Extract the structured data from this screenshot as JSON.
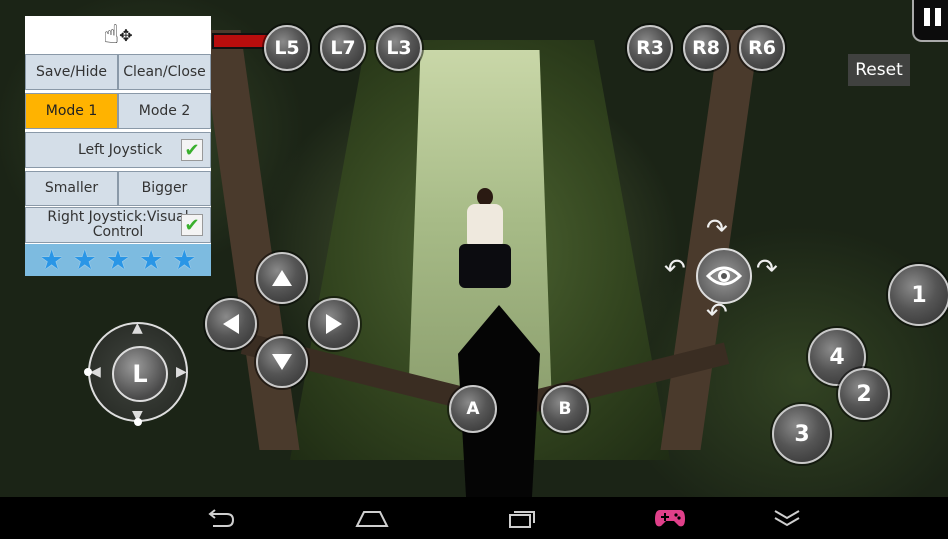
{
  "top_buttons_left": [
    "L5",
    "L7",
    "L3"
  ],
  "top_buttons_right": [
    "R3",
    "R8",
    "R6"
  ],
  "reset_label": "Reset",
  "panel": {
    "drag_icon": "hand-move-icon",
    "save_hide": "Save/Hide",
    "clean_close": "Clean/Close",
    "mode1": "Mode 1",
    "mode2": "Mode 2",
    "active_mode": "Mode 1",
    "left_joystick": "Left Joystick",
    "left_joystick_checked": true,
    "smaller": "Smaller",
    "bigger": "Bigger",
    "right_joystick_line1": "Right Joystick:Visual",
    "right_joystick_line2": "Control",
    "right_joystick_checked": true,
    "rating_stars": 5
  },
  "joystick_label": "L",
  "action_buttons": [
    "A",
    "B"
  ],
  "number_buttons": [
    "1",
    "4",
    "2",
    "3"
  ],
  "colors": {
    "active_mode": "#ffb300",
    "panel_cell": "#d4dee8",
    "stars_bg": "#7dbbe0",
    "star": "#2a96e6",
    "check": "#3ab02e",
    "gamepad_icon": "#e0408a"
  },
  "nav_icons": [
    "back-icon",
    "home-icon",
    "recents-icon",
    "gamepad-icon",
    "chevron-down-icon"
  ]
}
